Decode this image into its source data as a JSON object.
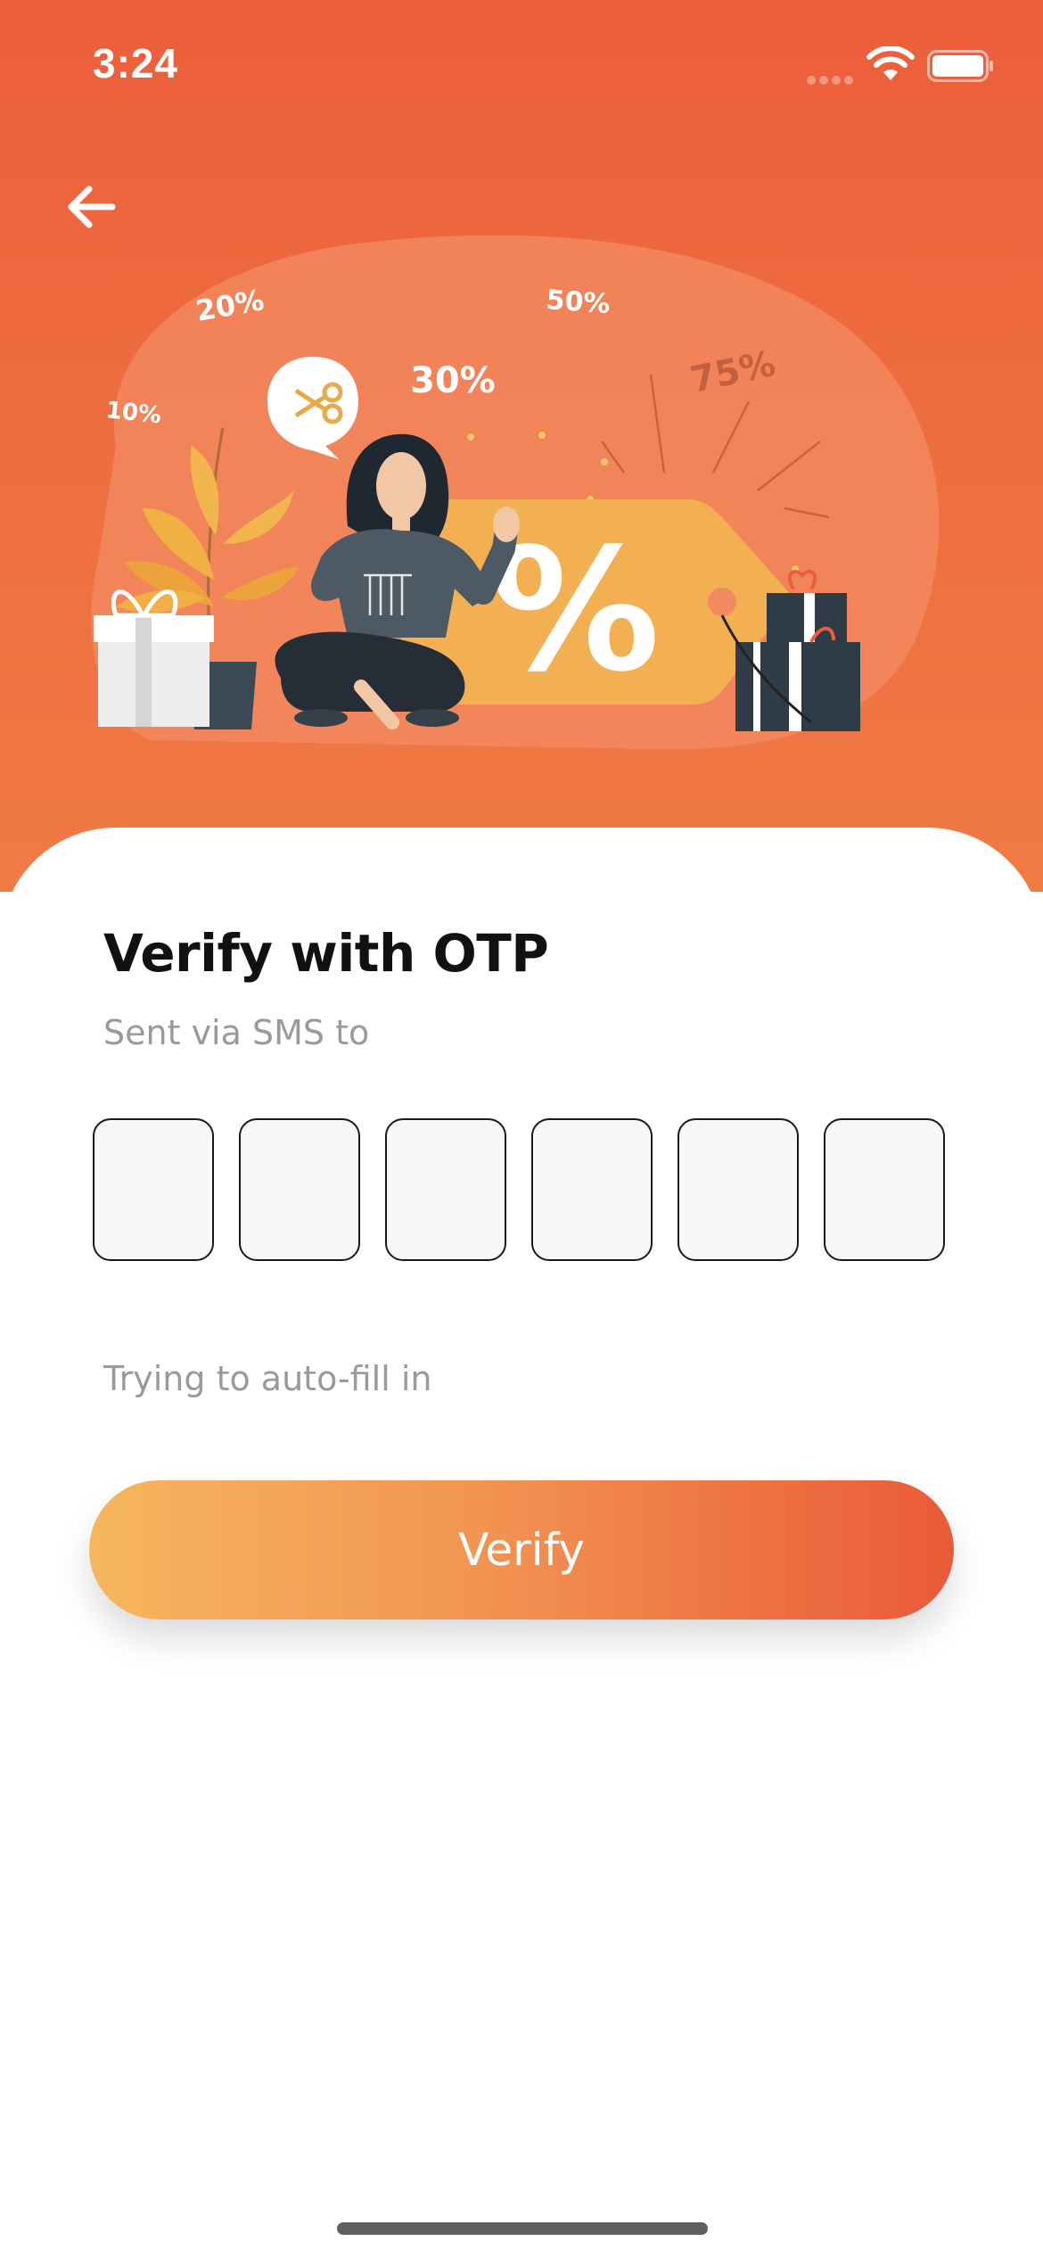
{
  "status_bar": {
    "time": "3:24"
  },
  "header": {
    "back_icon": "arrow-left-icon"
  },
  "illustration": {
    "discounts": [
      "10%",
      "20%",
      "30%",
      "50%",
      "75%"
    ],
    "tag_symbol": "%"
  },
  "main": {
    "title": "Verify with OTP",
    "subtitle": "Sent via SMS to",
    "otp": {
      "length": 6,
      "digits": [
        "",
        "",
        "",
        "",
        "",
        ""
      ]
    },
    "autofill_text": "Trying to auto-fill in",
    "verify_label": "Verify"
  },
  "colors": {
    "brand_orange": "#EB5E3A",
    "gradient_start": "#F6B65E",
    "gradient_end": "#EA5A38",
    "tag_yellow": "#F3B052",
    "input_bg": "#F6F7F9",
    "muted_text": "#9A9A9A"
  }
}
